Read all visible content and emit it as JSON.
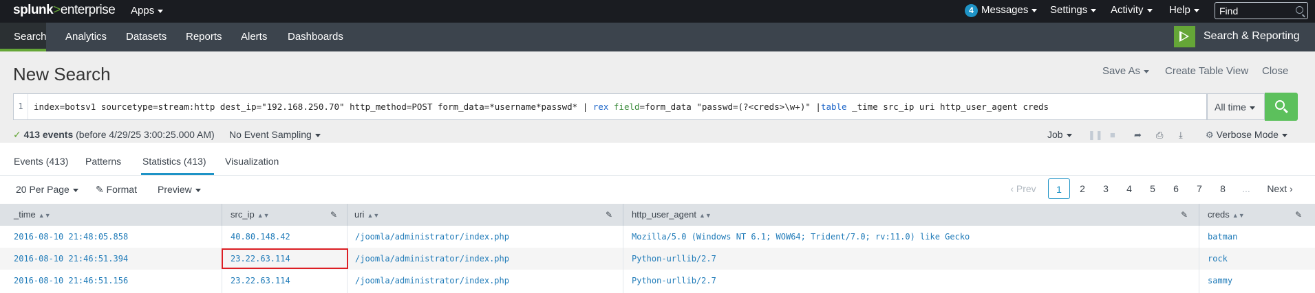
{
  "topbar": {
    "logo_brand": "splunk",
    "logo_gt": ">",
    "logo_product": "enterprise",
    "apps_label": "Apps",
    "messages_count": "4",
    "messages_label": "Messages",
    "settings_label": "Settings",
    "activity_label": "Activity",
    "help_label": "Help",
    "find_placeholder": "Find"
  },
  "appbar": {
    "items": [
      {
        "label": "Search",
        "active": true
      },
      {
        "label": "Analytics"
      },
      {
        "label": "Datasets"
      },
      {
        "label": "Reports"
      },
      {
        "label": "Alerts"
      },
      {
        "label": "Dashboards"
      }
    ],
    "app_name": "Search & Reporting"
  },
  "search": {
    "title": "New Search",
    "save_as": "Save As",
    "create_table_view": "Create Table View",
    "close": "Close",
    "line_number": "1",
    "query_part1": "index=botsv1 sourcetype=stream:http dest_ip=\"192.168.250.70\" http_method=POST form_data=*username*passwd* | ",
    "query_rex": "rex",
    "query_field": "field",
    "query_part2": "=form_data \"passwd=(?<creds>\\w+)\" |",
    "query_table": "table",
    "query_part3": " _time src_ip uri http_user_agent creds",
    "time_range": "All time"
  },
  "status": {
    "events_count": "413 events",
    "events_detail": "(before 4/29/25 3:00:25.000 AM)",
    "sampling": "No Event Sampling",
    "job": "Job",
    "mode": "Verbose Mode"
  },
  "tabs": [
    {
      "label": "Events (413)"
    },
    {
      "label": "Patterns"
    },
    {
      "label": "Statistics (413)",
      "active": true
    },
    {
      "label": "Visualization"
    }
  ],
  "table_controls": {
    "per_page": "20 Per Page",
    "format": "Format",
    "preview": "Preview",
    "prev": "Prev",
    "pages": [
      "1",
      "2",
      "3",
      "4",
      "5",
      "6",
      "7",
      "8",
      "..."
    ],
    "next": "Next"
  },
  "table": {
    "columns": [
      "_time",
      "src_ip",
      "uri",
      "http_user_agent",
      "creds"
    ],
    "rows": [
      [
        "2016-08-10 21:48:05.858",
        "40.80.148.42",
        "/joomla/administrator/index.php",
        "Mozilla/5.0 (Windows NT 6.1; WOW64; Trident/7.0; rv:11.0) like Gecko",
        "batman"
      ],
      [
        "2016-08-10 21:46:51.394",
        "23.22.63.114",
        "/joomla/administrator/index.php",
        "Python-urllib/2.7",
        "rock"
      ],
      [
        "2016-08-10 21:46:51.156",
        "23.22.63.114",
        "/joomla/administrator/index.php",
        "Python-urllib/2.7",
        "sammy"
      ]
    ],
    "highlight_color": "#dc1e24"
  },
  "colors": {
    "brand_green": "#65a637",
    "accent_blue": "#1e93c6",
    "search_button": "#5cc05c"
  }
}
